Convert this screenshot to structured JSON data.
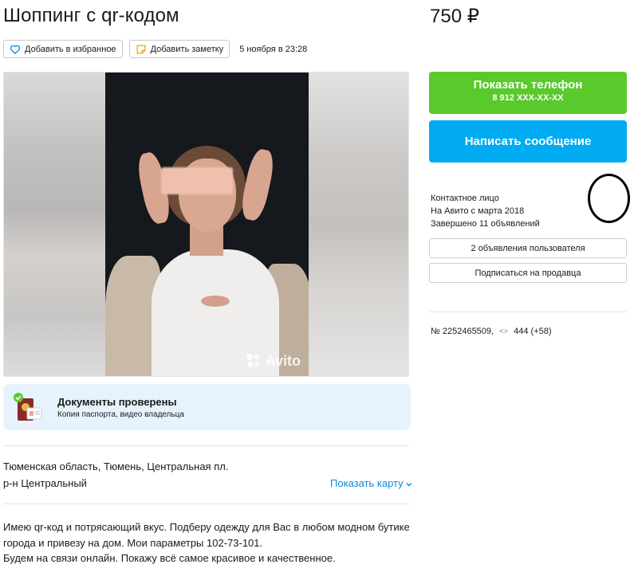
{
  "listing": {
    "title": "Шоппинг с qr-кодом",
    "price": "750 ₽",
    "date": "5 ноября в 23:28"
  },
  "actions": {
    "favorite_label": "Добавить в избранное",
    "note_label": "Добавить заметку"
  },
  "gallery": {
    "watermark": "Avito"
  },
  "documents": {
    "title": "Документы проверены",
    "subtitle": "Копия паспорта, видео владельца"
  },
  "location": {
    "address": "Тюменская область, Тюмень, Центральная пл.",
    "district": "р-н Центральный",
    "map_link": "Показать карту"
  },
  "description": {
    "line1": "Имею qr-код и потрясающий вкус. Подберу одежду для Вас в любом модном бутике",
    "line2": "города и привезу на дом. Мои параметры 102-73-101.",
    "line3": "Будем на связи онлайн. Покажу всё самое красивое и качественное."
  },
  "contact": {
    "phone_button_label": "Показать телефон",
    "phone_masked": "8 912 XXX-XX-XX",
    "message_button_label": "Написать сообщение",
    "contact_label": "Контактное лицо",
    "on_avito_since": "На Авито с марта 2018",
    "completed": "Завершено 11 объявлений",
    "user_ads_button": "2 объявления пользователя",
    "subscribe_button": "Подписаться на продавца"
  },
  "stats": {
    "ad_number": "№ 2252465509,",
    "views": "444 (+58)"
  },
  "colors": {
    "phone_button": "#5ac92c",
    "message_button": "#00abf2",
    "link": "#0a8bd6",
    "docs_background": "#e6f3fd"
  }
}
